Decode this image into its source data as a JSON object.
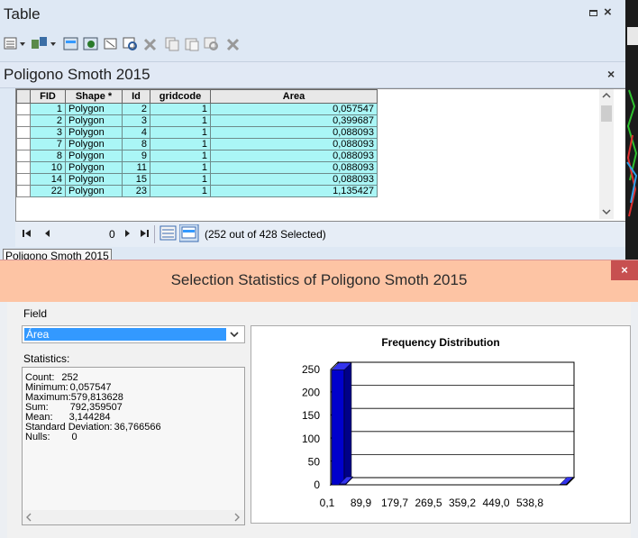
{
  "table_window": {
    "title": "Table",
    "close_glyph": "×",
    "table_name": "Poligono Smoth 2015",
    "columns": [
      "FID",
      "Shape *",
      "Id",
      "gridcode",
      "Area"
    ],
    "rows": [
      [
        "1",
        "Polygon",
        "2",
        "1",
        "0,057547"
      ],
      [
        "2",
        "Polygon",
        "3",
        "1",
        "0,399687"
      ],
      [
        "3",
        "Polygon",
        "4",
        "1",
        "0,088093"
      ],
      [
        "7",
        "Polygon",
        "8",
        "1",
        "0,088093"
      ],
      [
        "8",
        "Polygon",
        "9",
        "1",
        "0,088093"
      ],
      [
        "10",
        "Polygon",
        "11",
        "1",
        "0,088093"
      ],
      [
        "14",
        "Polygon",
        "15",
        "1",
        "0,088093"
      ],
      [
        "22",
        "Polygon",
        "23",
        "1",
        "1,135427"
      ]
    ],
    "nav": {
      "first": "⏮",
      "prev": "◂",
      "record": "0",
      "next": "▸",
      "last": "⏭",
      "selection_text": "(252 out of 428 Selected)"
    },
    "tab_label": "Poligono Smoth 2015"
  },
  "dialog": {
    "title": "Selection Statistics of Poligono Smoth 2015",
    "close_glyph": "×",
    "field_label": "Field",
    "field_value": "Área",
    "statistics_label": "Statistics:",
    "stats": [
      {
        "label": "Count:",
        "value": "252"
      },
      {
        "label": "Minimum:",
        "value": "0,057547"
      },
      {
        "label": "Maximum:",
        "value": "579,813628"
      },
      {
        "label": "Sum:",
        "value": "792,359507"
      },
      {
        "label": "Mean:",
        "value": "3,144284"
      },
      {
        "label": "Standard Deviation:",
        "value": "36,766566"
      },
      {
        "label": "Nulls:",
        "value": "0"
      }
    ]
  },
  "chart_data": {
    "type": "bar",
    "title": "Frequency Distribution",
    "x_tick_labels": [
      "0,1",
      "89,9",
      "179,7",
      "269,5",
      "359,2",
      "449,0",
      "538,8"
    ],
    "y_tick_labels": [
      "250",
      "200",
      "150",
      "100",
      "50",
      "0"
    ],
    "ylim": [
      0,
      250
    ],
    "values": [
      249,
      2,
      0,
      0,
      0,
      0,
      0,
      0,
      0,
      0,
      0,
      0,
      0,
      0,
      0,
      0,
      0,
      0,
      0,
      0,
      0,
      0,
      0,
      0,
      0,
      0,
      0,
      0,
      0,
      1
    ],
    "bar_color": "#0000cc",
    "grid": true
  }
}
